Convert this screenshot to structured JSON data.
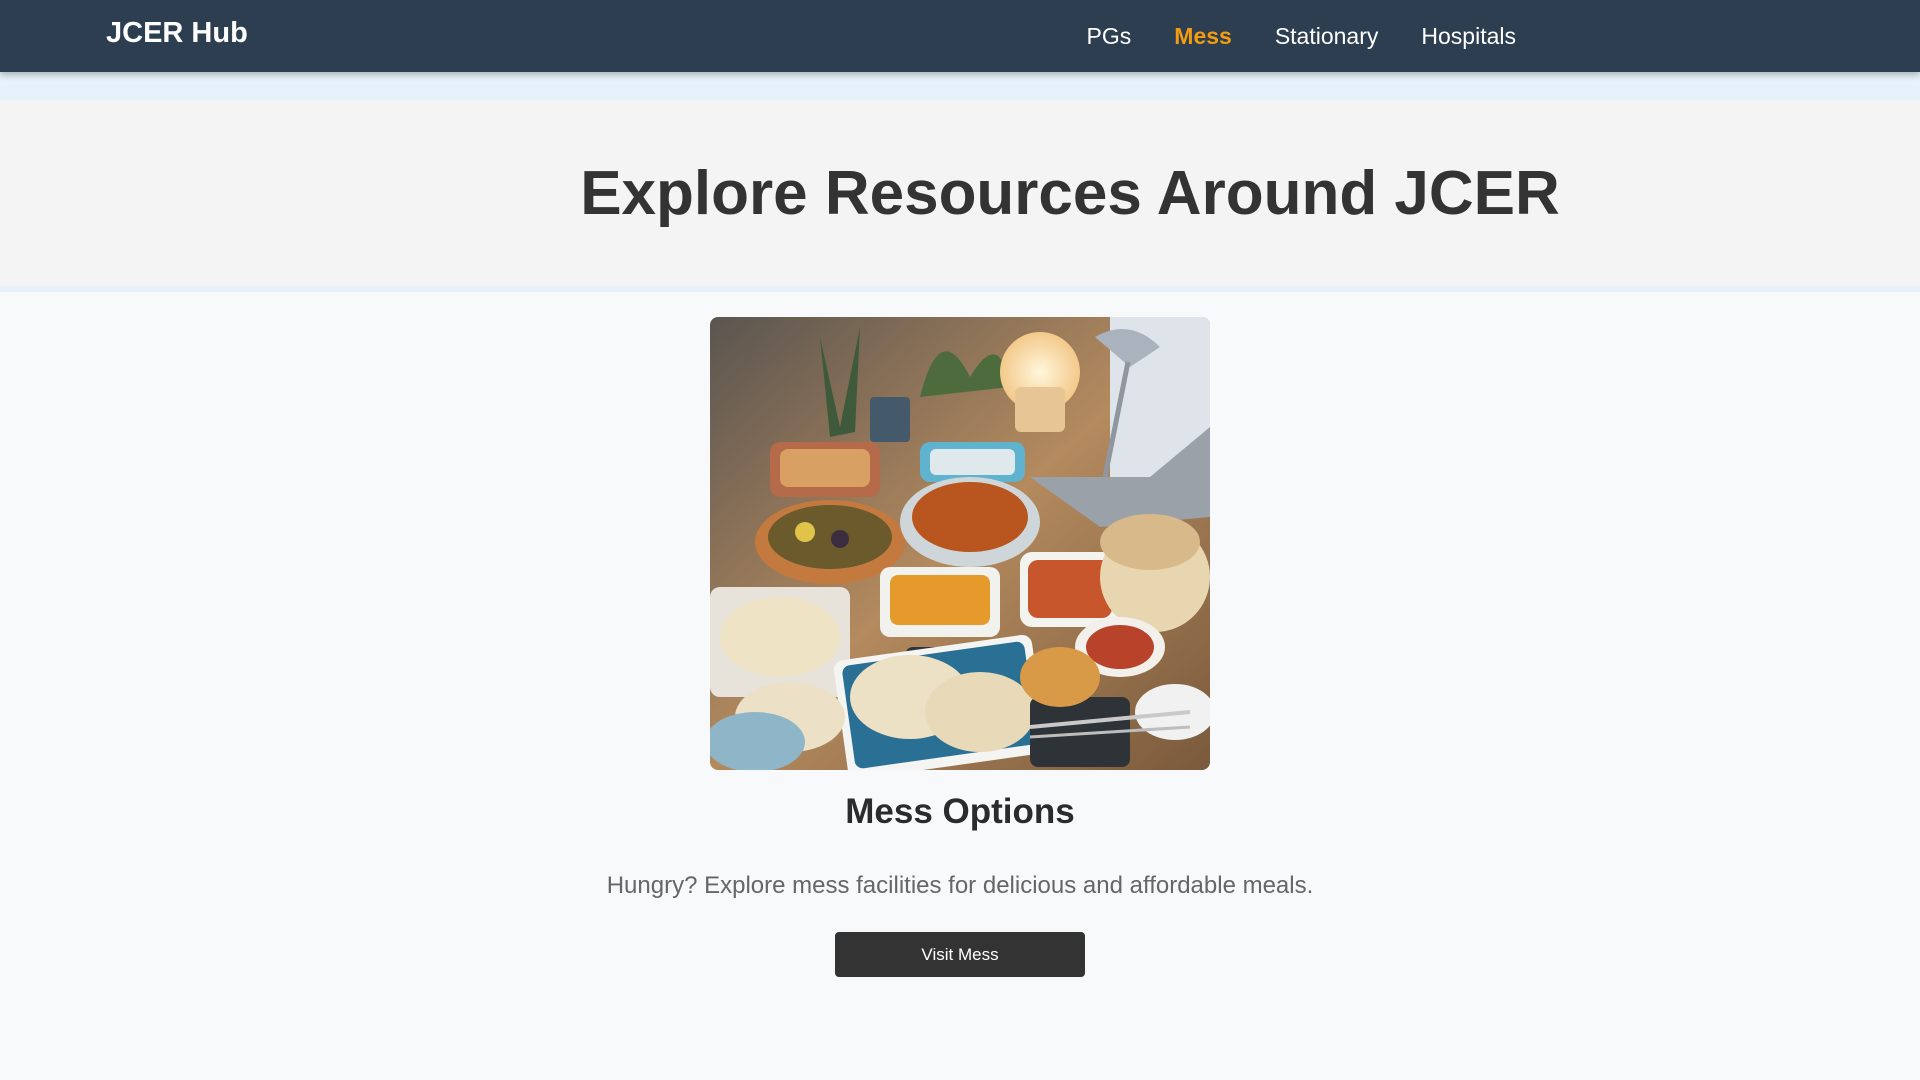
{
  "navbar": {
    "brand": "JCER Hub",
    "links": [
      {
        "label": "PGs",
        "active": false
      },
      {
        "label": "Mess",
        "active": true
      },
      {
        "label": "Stationary",
        "active": false
      },
      {
        "label": "Hospitals",
        "active": false
      }
    ],
    "accent_color": "#f39c12",
    "background_color": "#2c3e50"
  },
  "hero": {
    "title": "Explore Resources Around JCER"
  },
  "card": {
    "image_icon": "food-table-photo",
    "title": "Mess Options",
    "description": "Hungry? Explore mess facilities for delicious and affordable meals.",
    "button_label": "Visit Mess",
    "button_color": "#333333"
  }
}
